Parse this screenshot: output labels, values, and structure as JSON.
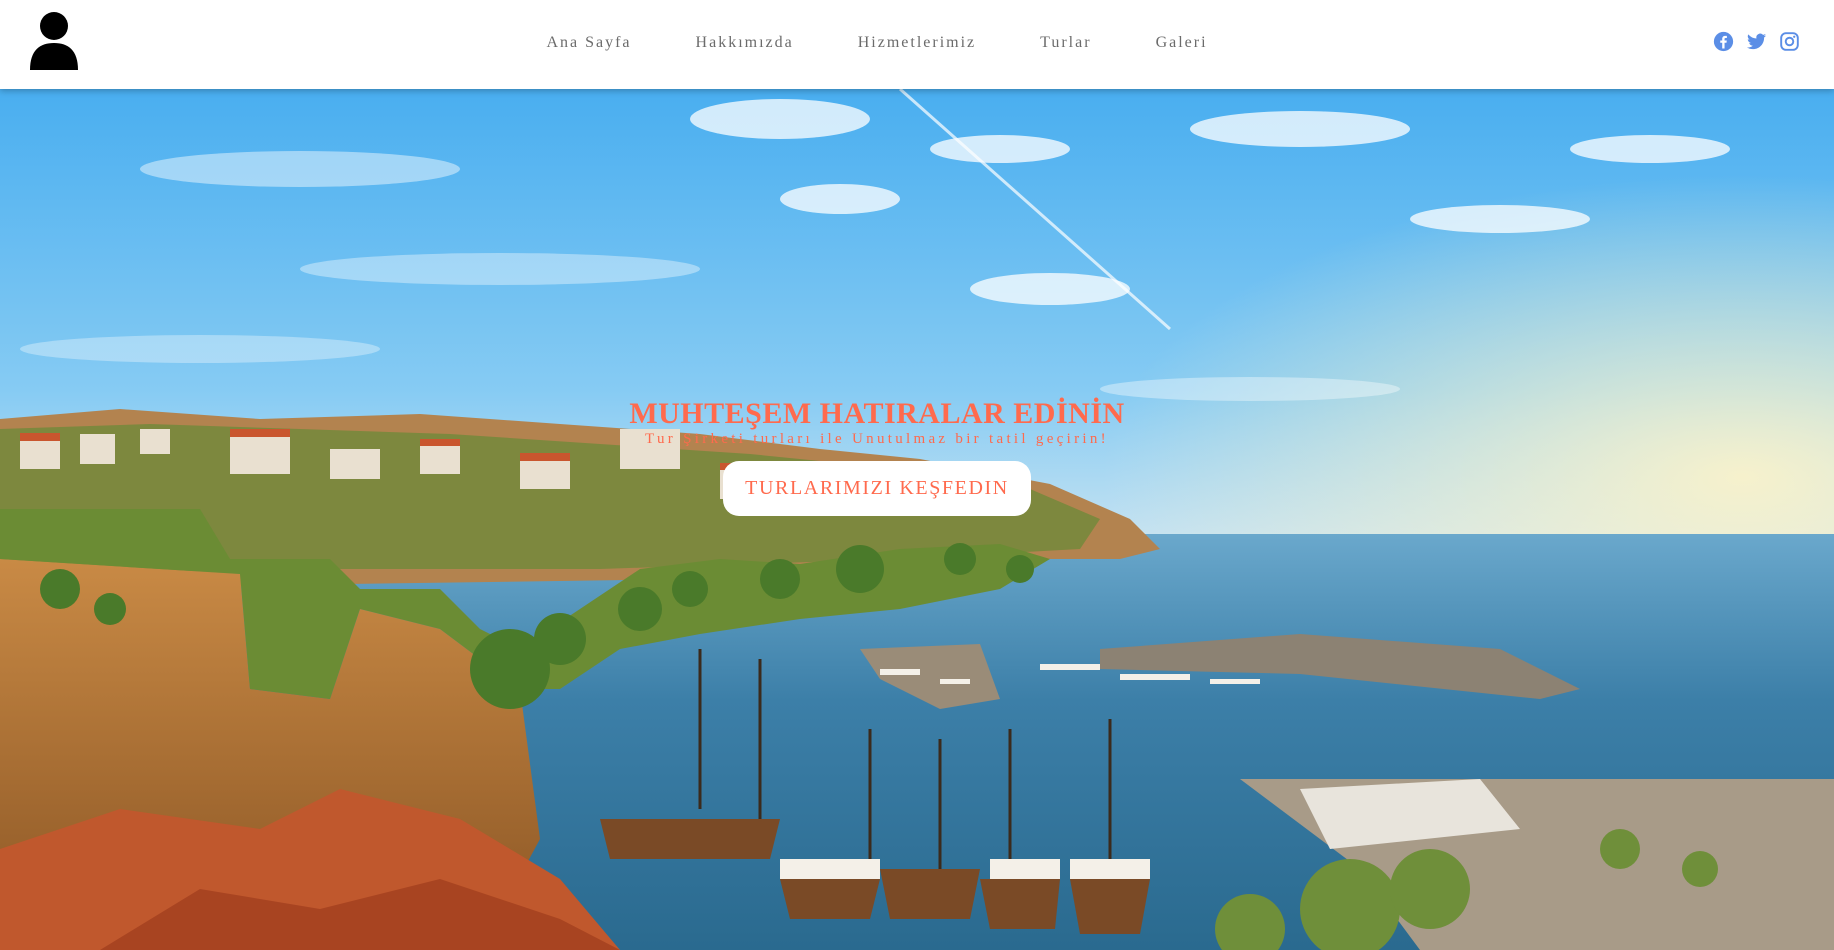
{
  "nav": {
    "logo_icon": "user-icon",
    "items": [
      {
        "label": "Ana Sayfa"
      },
      {
        "label": "Hakkımızda"
      },
      {
        "label": "Hizmetlerimiz"
      },
      {
        "label": "Turlar"
      },
      {
        "label": "Galeri"
      }
    ],
    "socials": [
      {
        "icon": "facebook-icon"
      },
      {
        "icon": "twitter-icon"
      },
      {
        "icon": "instagram-icon"
      }
    ]
  },
  "hero": {
    "title": "MUHTEŞEM HATIRALAR EDİNİN",
    "subtitle": "Tur Şirketi turları ile Unutulmaz bir tatil geçirin!",
    "cta_label": "TURLARIMIZI KEŞFEDIN",
    "background": "harbor-city-photo"
  },
  "colors": {
    "accent": "#ff6a4d",
    "nav_text": "#6b6b6b",
    "social_icons": "#5b8ee6",
    "navbar_bg": "#ffffff"
  }
}
